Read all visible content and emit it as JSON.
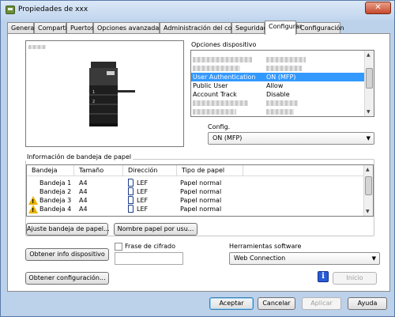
{
  "window": {
    "title": "Propiedades de xxx",
    "close_glyph": "✕"
  },
  "tabs": [
    {
      "label": "General"
    },
    {
      "label": "Compartir"
    },
    {
      "label": "Puertos"
    },
    {
      "label": "Opciones avanzadas"
    },
    {
      "label": "Administración del color"
    },
    {
      "label": "Seguridad"
    },
    {
      "label": "Configurar",
      "active": true
    },
    {
      "label": "Configuración"
    }
  ],
  "device_options": {
    "label": "Opciones dispositivo",
    "rows": [
      {
        "name": "",
        "value": "",
        "blurred": true
      },
      {
        "name": "",
        "value": "",
        "blurred": true
      },
      {
        "name": "User Authentication",
        "value": "ON (MFP)",
        "selected": true
      },
      {
        "name": "Public User",
        "value": "Allow"
      },
      {
        "name": "Account Track",
        "value": "Disable"
      },
      {
        "name": "",
        "value": "",
        "blurred": true
      },
      {
        "name": "",
        "value": "",
        "blurred": true
      }
    ],
    "config_label": "Config.",
    "config_value": "ON (MFP)"
  },
  "tray_info": {
    "label": "Información de bandeja de papel",
    "columns": [
      "Bandeja",
      "Tamaño",
      "Dirección",
      "Tipo de papel"
    ],
    "rows": [
      {
        "tray": "Bandeja 1",
        "size": "A4",
        "direction": "LEF",
        "type": "Papel normal",
        "warning": false
      },
      {
        "tray": "Bandeja 2",
        "size": "A4",
        "direction": "LEF",
        "type": "Papel normal",
        "warning": false
      },
      {
        "tray": "Bandeja 3",
        "size": "A4",
        "direction": "LEF",
        "type": "Papel normal",
        "warning": true
      },
      {
        "tray": "Bandeja 4",
        "size": "A4",
        "direction": "LEF",
        "type": "Papel normal",
        "warning": true
      }
    ],
    "adjust_button": "Ajuste bandeja de papel...",
    "paper_name_button": "Nombre papel por usu..."
  },
  "actions": {
    "get_device_info": "Obtener info dispositivo",
    "get_config": "Obtener configuración...",
    "encryption_phrase_label": "Frase de cifrado",
    "encryption_phrase_value": "",
    "software_tools_label": "Herramientas software",
    "software_tools_value": "Web Connection",
    "start_button": "Inicio"
  },
  "footer": {
    "accept": "Aceptar",
    "cancel": "Cancelar",
    "apply": "Aplicar",
    "help": "Ayuda"
  },
  "colors": {
    "selection": "#3399ff",
    "warning": "#e8b400",
    "info": "#2a5bd7"
  }
}
